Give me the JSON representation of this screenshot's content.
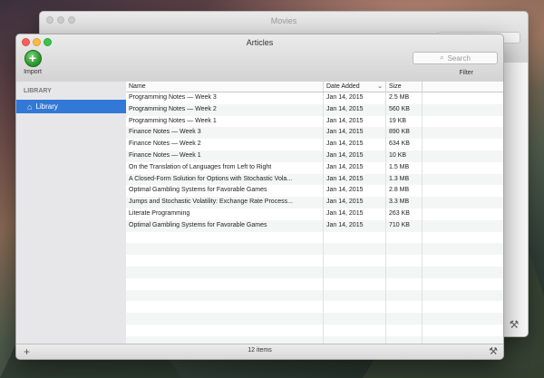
{
  "back_window": {
    "title": "Movies"
  },
  "window": {
    "title": "Articles",
    "import_label": "Import",
    "import_symbol": "+",
    "search_placeholder": "Search",
    "filter_label": "Filter"
  },
  "sidebar": {
    "header": "LIBRARY",
    "items": [
      {
        "label": "Library",
        "icon": "house-icon",
        "selected": true
      }
    ]
  },
  "table": {
    "columns": {
      "name": "Name",
      "date": "Date Added",
      "size": "Size"
    },
    "rows": [
      {
        "name": "Programming Notes — Week 3",
        "date": "Jan 14, 2015",
        "size": "2.5 MB"
      },
      {
        "name": "Programming Notes — Week 2",
        "date": "Jan 14, 2015",
        "size": "560 KB"
      },
      {
        "name": "Programming Notes — Week 1",
        "date": "Jan 14, 2015",
        "size": "19 KB"
      },
      {
        "name": "Finance Notes — Week 3",
        "date": "Jan 14, 2015",
        "size": "890 KB"
      },
      {
        "name": "Finance Notes — Week 2",
        "date": "Jan 14, 2015",
        "size": "634 KB"
      },
      {
        "name": "Finance Notes — Week 1",
        "date": "Jan 14, 2015",
        "size": "10 KB"
      },
      {
        "name": "On the Translation of Languages from Left to Right",
        "date": "Jan 14, 2015",
        "size": "1.5 MB"
      },
      {
        "name": "A Closed-Form Solution for Options with Stochastic Vola...",
        "date": "Jan 14, 2015",
        "size": "1.3 MB"
      },
      {
        "name": "Optimal Gambling Systems for Favorable Games",
        "date": "Jan 14, 2015",
        "size": "2.8 MB"
      },
      {
        "name": "Jumps and Stochastic Volatility: Exchange Rate Process...",
        "date": "Jan 14, 2015",
        "size": "3.3 MB"
      },
      {
        "name": "Literate Programming",
        "date": "Jan 14, 2015",
        "size": "263 KB"
      },
      {
        "name": "Optimal Gambling Systems for Favorable Games",
        "date": "Jan 14, 2015",
        "size": "710 KB"
      }
    ]
  },
  "status": {
    "item_count": "12 items"
  },
  "colors": {
    "selection": "#3279d7",
    "import_green": "#2e9a2f"
  }
}
